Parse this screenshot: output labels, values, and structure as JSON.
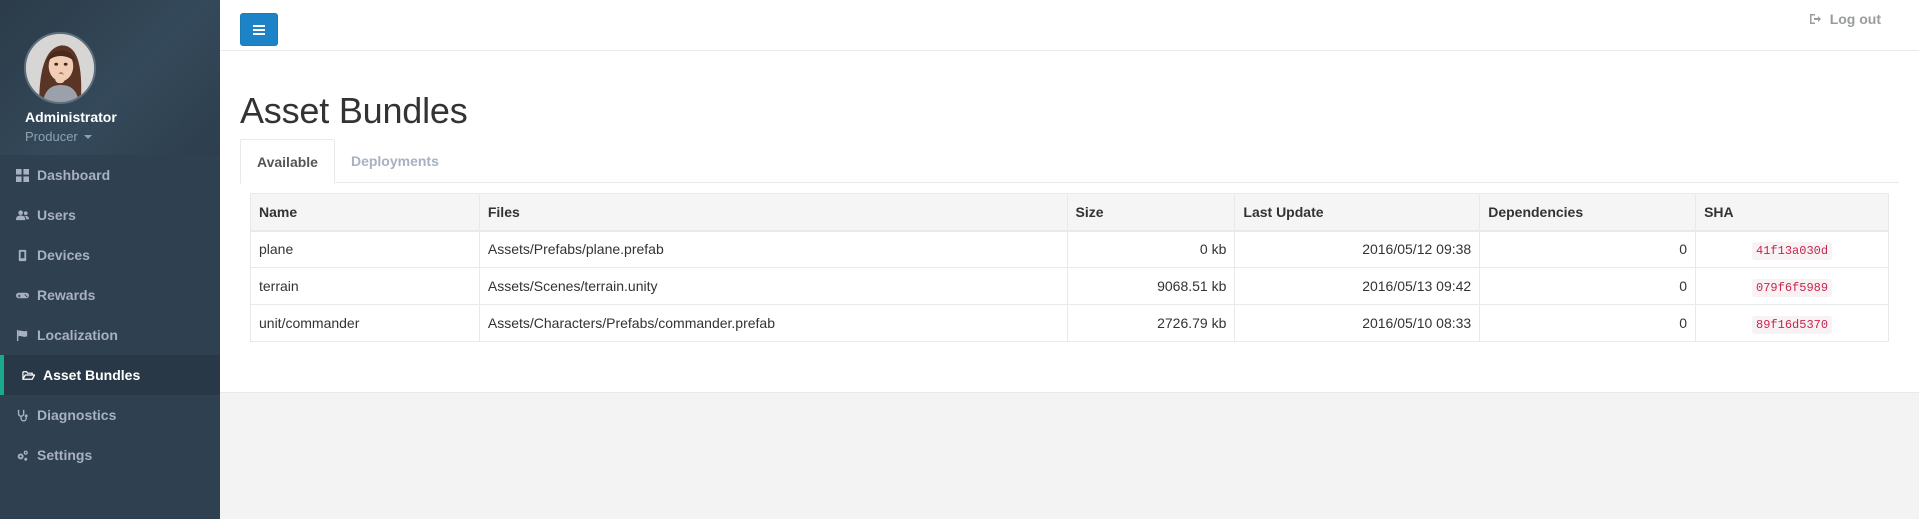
{
  "user": {
    "name": "Administrator",
    "role": "Producer"
  },
  "nav": [
    {
      "label": "Dashboard",
      "icon": "dashboard-icon"
    },
    {
      "label": "Users",
      "icon": "users-icon"
    },
    {
      "label": "Devices",
      "icon": "mobile-icon"
    },
    {
      "label": "Rewards",
      "icon": "gamepad-icon"
    },
    {
      "label": "Localization",
      "icon": "flag-icon"
    },
    {
      "label": "Asset Bundles",
      "icon": "folder-open-icon",
      "active": true
    },
    {
      "label": "Diagnostics",
      "icon": "stethoscope-icon"
    },
    {
      "label": "Settings",
      "icon": "cogs-icon"
    }
  ],
  "topbar": {
    "logout_label": "Log out"
  },
  "page": {
    "title": "Asset Bundles",
    "tabs": [
      {
        "label": "Available",
        "active": true
      },
      {
        "label": "Deployments"
      }
    ]
  },
  "table": {
    "columns": [
      "Name",
      "Files",
      "Size",
      "Last Update",
      "Dependencies",
      "SHA"
    ],
    "rows": [
      {
        "name": "plane",
        "files": "Assets/Prefabs/plane.prefab",
        "size": "0 kb",
        "last_update": "2016/05/12 09:38",
        "dependencies": "0",
        "sha": "41f13a030d"
      },
      {
        "name": "terrain",
        "files": "Assets/Scenes/terrain.unity",
        "size": "9068.51 kb",
        "last_update": "2016/05/13 09:42",
        "dependencies": "0",
        "sha": "079f6f5989"
      },
      {
        "name": "unit/commander",
        "files": "Assets/Characters/Prefabs/commander.prefab",
        "size": "2726.79 kb",
        "last_update": "2016/05/10 08:33",
        "dependencies": "0",
        "sha": "89f16d5370"
      }
    ]
  },
  "colors": {
    "sidebar": "#2f4050",
    "accent": "#19aa8d",
    "primary_button": "#1c84c6",
    "code_text": "#c7254e"
  }
}
